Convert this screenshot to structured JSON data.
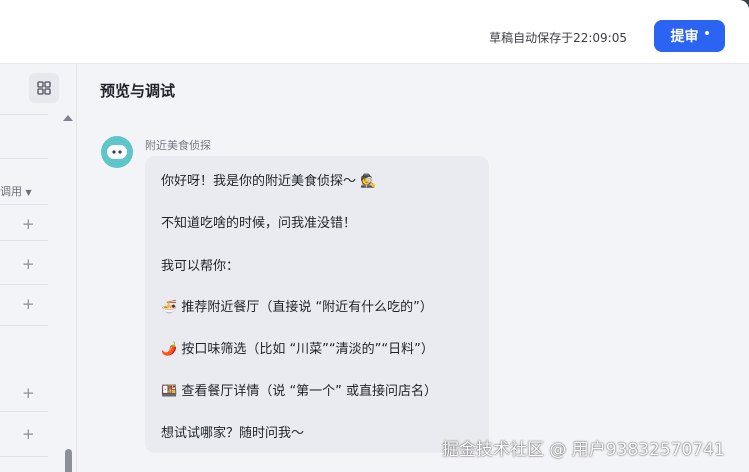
{
  "header": {
    "draft_status": "草稿自动保存于22:09:05",
    "submit_label": "提审"
  },
  "left_panel": {
    "partial_label": "调用"
  },
  "preview": {
    "title": "预览与调试"
  },
  "chat": {
    "bot_name": "附近美食侦探",
    "lines": [
      "你好呀！我是你的附近美食侦探～ 🕵️",
      "不知道吃啥的时候，问我准没错！",
      "我可以帮你：",
      "🍜 推荐附近餐厅（直接说 “附近有什么吃的”）",
      "🌶️ 按口味筛选（比如 “川菜”“清淡的”“日料”）",
      "🍱 查看餐厅详情（说 “第一个” 或直接问店名）",
      "想试试哪家？随时问我～"
    ]
  },
  "watermark": "掘金技术社区 @ 用户93832570741",
  "colors": {
    "accent": "#2b63f2",
    "avatar": "#5ec5c9",
    "bubble": "#e9ebf0"
  },
  "icons": [
    "layout-grid-icon",
    "plus-icon",
    "chevron-down-icon",
    "scroll-up-icon",
    "bot-avatar-icon"
  ]
}
